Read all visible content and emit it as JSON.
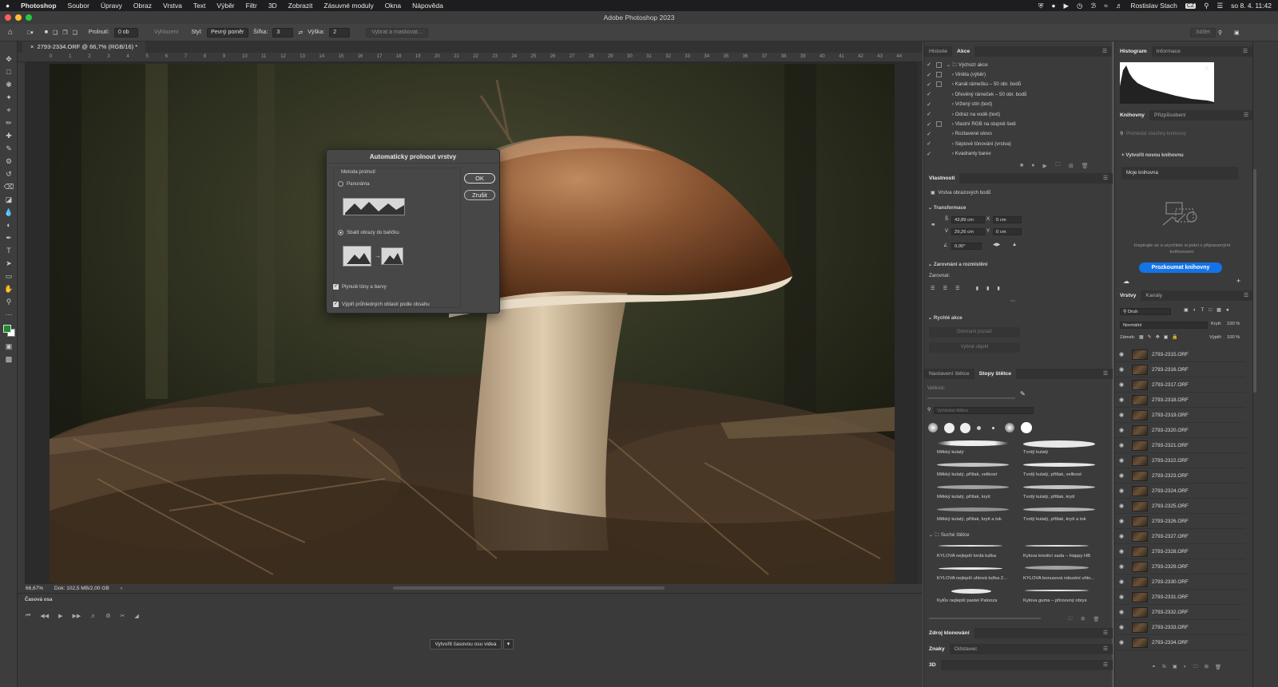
{
  "menubar": {
    "apple": "",
    "items": [
      "Photoshop",
      "Soubor",
      "Úpravy",
      "Obraz",
      "Vrstva",
      "Text",
      "Výběr",
      "Filtr",
      "3D",
      "Zobrazit",
      "Zásuvné moduly",
      "Okna",
      "Nápověda"
    ],
    "user": "Rostislav Stach",
    "keyboard": "CZ",
    "datetime": "so 8. 4.  11:42"
  },
  "window": {
    "title": "Adobe Photoshop 2023"
  },
  "options": {
    "feather_label": "Prolnutí:",
    "feather_value": "0 ob",
    "smooth_label": "Vyhlazení",
    "style_label": "Styl:",
    "style_value": "Pevný poměr",
    "width_label": "Šířka:",
    "width_value": "3",
    "height_label": "Výška:",
    "height_value": "2",
    "select_mask": "Vybrat a maskovat...",
    "share": "Sdílet"
  },
  "document": {
    "tab": "2793-2334.ORF @ 66,7% (RGB/16) *"
  },
  "ruler_ticks": [
    "0",
    "1",
    "2",
    "3",
    "4",
    "5",
    "6",
    "7",
    "8",
    "9",
    "10",
    "11",
    "12",
    "13",
    "14",
    "15",
    "16",
    "17",
    "18",
    "19",
    "20",
    "21",
    "22",
    "23",
    "24",
    "25",
    "26",
    "27",
    "28",
    "29",
    "30",
    "31",
    "32",
    "33",
    "34",
    "35",
    "36",
    "37",
    "38",
    "39",
    "40",
    "41",
    "42",
    "43",
    "44"
  ],
  "status": {
    "zoom": "66,67%",
    "doc": "Dok: 102,5 MB/2,00 GB"
  },
  "timeline": {
    "title": "Časová osa",
    "create_button": "Vytvořit časovou osu videa"
  },
  "dialog": {
    "title": "Automaticky prolnout vrstvy",
    "method_label": "Metoda prolnutí",
    "panorama": "Panoráma",
    "stack": "Sbalit obrazy do balíčku",
    "seamless": "Plynulé tóny a barvy",
    "content_fill": "Výplň průhledných oblastí podle obsahu",
    "ok": "OK",
    "cancel": "Zrušit"
  },
  "history_panel": {
    "tabs": [
      "Historie",
      "Akce"
    ],
    "actions": [
      "Výchozí akce",
      "Viněta (výběr)",
      "Kanál rámečku – 50 obr. bodů",
      "Dřevěný rámeček – 50 obr. bodů",
      "Vržený stín (text)",
      "Odraz na vodě (text)",
      "Vlastní RGB na stupně šedi",
      "Roztavené olovo",
      "Sépiové tónování (vrstva)",
      "Kvadranty barev"
    ]
  },
  "properties": {
    "title": "Vlastnosti",
    "layer_type": "Vrstva obrazových bodů",
    "transform": "Transformace",
    "w_label": "Š",
    "w": "43,89 cm",
    "x_label": "X",
    "x": "0 cm",
    "h_label": "V",
    "h": "29,26 cm",
    "y_label": "Y",
    "y": "0 cm",
    "angle": "0,00°",
    "align_title": "Zarovnání a rozmístění",
    "align_label": "Zarovnat:",
    "quick_title": "Rychlé akce",
    "remove_bg": "Odstranit pozadí",
    "select_subject": "Vybrat objekt"
  },
  "brushes": {
    "tabs": [
      "Nastavení štětce",
      "Stopy štětce"
    ],
    "size_label": "Velikost:",
    "search_placeholder": "Vyhledat štětce",
    "items": [
      "Měkký kulatý",
      "Tvrdý kulatý",
      "Měkký kulatý, přítlak, velikost",
      "Tvrdý kulatý, přítlak, velikost",
      "Měkký kulatý, přítlak, krytí",
      "Tvrdý kulatý, přítlak, krytí",
      "Měkký kulatý, přítlak, krytí a tok",
      "Tvrdý kulatý, přítlak, krytí a tok"
    ],
    "group": "Suché štětce",
    "dry": [
      "KYLOVA nejlepší tvrdá tužka",
      "Kylova kreslicí sada – Happy HB",
      "KYLOVA nejlepší uhlová tužka 2...",
      "KYLOVA bonusová robustní uhlo...",
      "Kylův nejlepší pastel Palooza",
      "Kylova guma – přirozený obrys"
    ]
  },
  "bottom_panels": {
    "clone": "Zdroj klonování",
    "tabs": [
      "Znaky",
      "Odstavec"
    ],
    "three_d": "3D"
  },
  "histogram": {
    "tabs": [
      "Histogram",
      "Informace"
    ]
  },
  "libraries": {
    "tabs": [
      "Knihovny",
      "Přizpůsobení"
    ],
    "search_placeholder": "Prohledat všechny knihovny",
    "create": "Vytvořit novou knihovnu",
    "mine": "Moje knihovna",
    "hint": "Inspirujte se a urychlete si práci s připravenými knihovnami.",
    "explore": "Prozkoumat knihovny"
  },
  "layers": {
    "tabs": [
      "Vrstvy",
      "Kanály"
    ],
    "filter": "Druh",
    "blend": "Normální",
    "opacity_label": "Krytí:",
    "opacity": "100 %",
    "lock_label": "Zámek:",
    "fill_label": "Výplň:",
    "fill": "100 %",
    "items": [
      "2793-2315.ORF",
      "2793-2316.ORF",
      "2793-2317.ORF",
      "2793-2318.ORF",
      "2793-2319.ORF",
      "2793-2320.ORF",
      "2793-2321.ORF",
      "2793-2322.ORF",
      "2793-2323.ORF",
      "2793-2324.ORF",
      "2793-2325.ORF",
      "2793-2326.ORF",
      "2793-2327.ORF",
      "2793-2328.ORF",
      "2793-2329.ORF",
      "2793-2330.ORF",
      "2793-2331.ORF",
      "2793-2332.ORF",
      "2793-2333.ORF",
      "2793-2334.ORF"
    ]
  },
  "colors": {
    "accent": "#1473e6",
    "foreground": "#1f8a2e",
    "background": "#ffffff"
  }
}
